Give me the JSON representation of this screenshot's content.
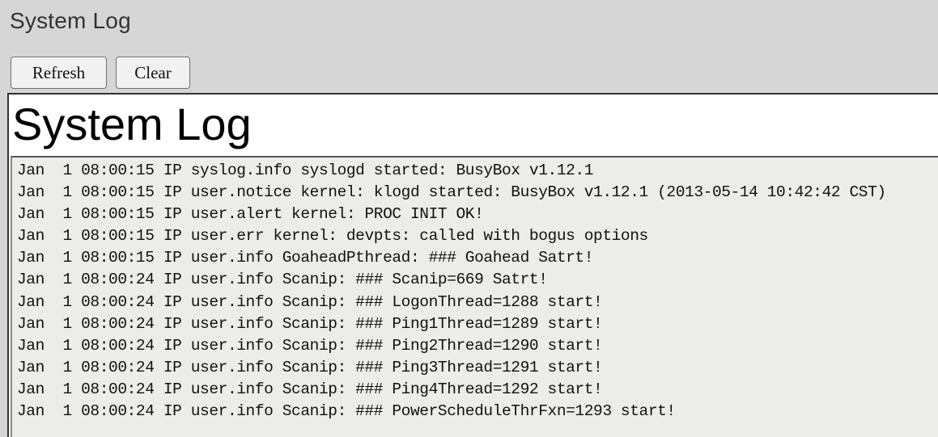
{
  "page": {
    "title": "System Log"
  },
  "toolbar": {
    "refresh_label": "Refresh",
    "clear_label": "Clear"
  },
  "content": {
    "heading": "System Log",
    "log_lines": [
      "Jan  1 08:00:15 IP syslog.info syslogd started: BusyBox v1.12.1",
      "Jan  1 08:00:15 IP user.notice kernel: klogd started: BusyBox v1.12.1 (2013-05-14 10:42:42 CST)",
      "Jan  1 08:00:15 IP user.alert kernel: PROC INIT OK!",
      "Jan  1 08:00:15 IP user.err kernel: devpts: called with bogus options",
      "Jan  1 08:00:15 IP user.info GoaheadPthread: ### Goahead Satrt!",
      "Jan  1 08:00:24 IP user.info Scanip: ### Scanip=669 Satrt!",
      "Jan  1 08:00:24 IP user.info Scanip: ### LogonThread=1288 start!",
      "Jan  1 08:00:24 IP user.info Scanip: ### Ping1Thread=1289 start!",
      "Jan  1 08:00:24 IP user.info Scanip: ### Ping2Thread=1290 start!",
      "Jan  1 08:00:24 IP user.info Scanip: ### Ping3Thread=1291 start!",
      "Jan  1 08:00:24 IP user.info Scanip: ### Ping4Thread=1292 start!",
      "Jan  1 08:00:24 IP user.info Scanip: ### PowerScheduleThrFxn=1293 start!"
    ]
  }
}
